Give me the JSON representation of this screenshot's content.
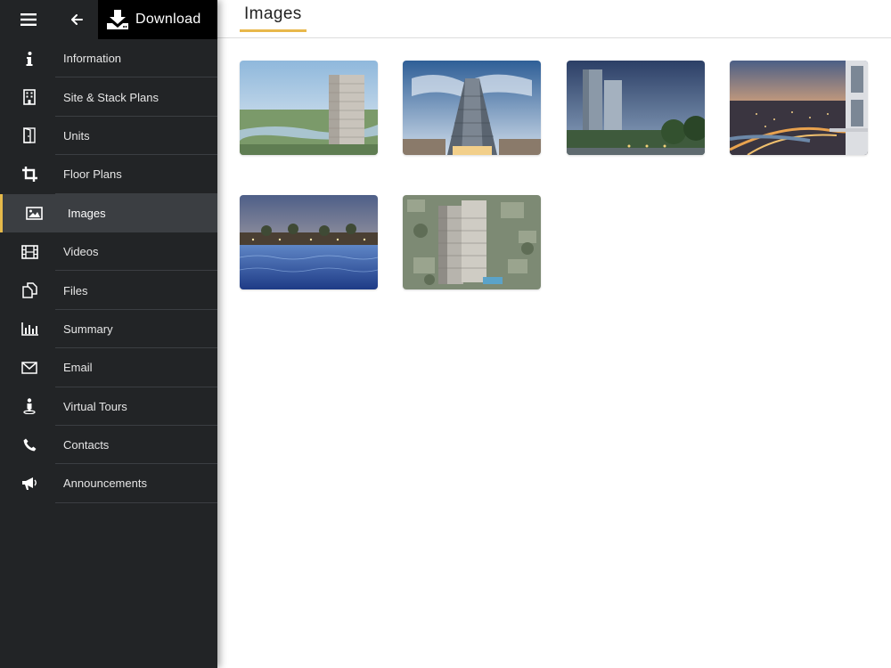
{
  "topbar": {
    "download_label": "Download"
  },
  "nav": {
    "items": [
      {
        "label": "Information",
        "icon": "info-icon"
      },
      {
        "label": "Site & Stack Plans",
        "icon": "building-icon"
      },
      {
        "label": "Units",
        "icon": "door-icon"
      },
      {
        "label": "Floor Plans",
        "icon": "crop-icon"
      },
      {
        "label": "Images",
        "icon": "image-icon",
        "active": true
      },
      {
        "label": "Videos",
        "icon": "film-icon"
      },
      {
        "label": "Files",
        "icon": "files-icon"
      },
      {
        "label": "Summary",
        "icon": "bar-chart-icon"
      },
      {
        "label": "Email",
        "icon": "envelope-icon"
      },
      {
        "label": "Virtual Tours",
        "icon": "person-pin-icon"
      },
      {
        "label": "Contacts",
        "icon": "phone-icon"
      },
      {
        "label": "Announcements",
        "icon": "megaphone-icon"
      }
    ]
  },
  "main": {
    "title": "Images"
  },
  "colors": {
    "sidebar_bg": "#222426",
    "active_bg": "#3b3e42",
    "accent": "#e5b94a"
  }
}
